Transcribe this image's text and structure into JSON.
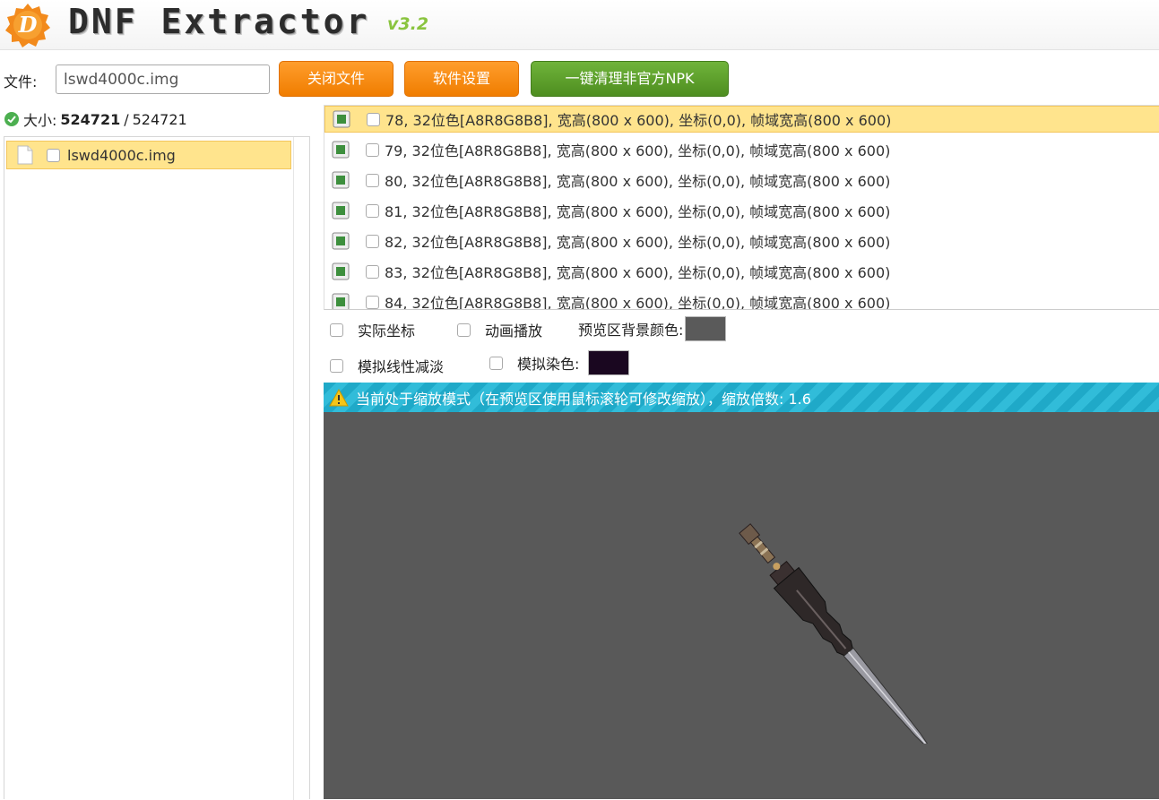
{
  "app": {
    "title": "DNF Extractor",
    "version": "v3.2",
    "logo_letter": "D"
  },
  "toolbar": {
    "file_label": "文件:",
    "file_value": "lswd4000c.img",
    "close_file": "关闭文件",
    "settings": "软件设置",
    "clean_npk": "一键清理非官方NPK"
  },
  "size": {
    "label": "大小:",
    "current": "524721",
    "separator": "/",
    "total": "524721"
  },
  "tree": {
    "items": [
      {
        "label": "lswd4000c.img",
        "selected": true
      }
    ]
  },
  "frames": [
    {
      "text": "78, 32位色[A8R8G8B8], 宽高(800 x 600), 坐标(0,0), 帧域宽高(800 x 600)",
      "selected": true
    },
    {
      "text": "79, 32位色[A8R8G8B8], 宽高(800 x 600), 坐标(0,0), 帧域宽高(800 x 600)",
      "selected": false
    },
    {
      "text": "80, 32位色[A8R8G8B8], 宽高(800 x 600), 坐标(0,0), 帧域宽高(800 x 600)",
      "selected": false
    },
    {
      "text": "81, 32位色[A8R8G8B8], 宽高(800 x 600), 坐标(0,0), 帧域宽高(800 x 600)",
      "selected": false
    },
    {
      "text": "82, 32位色[A8R8G8B8], 宽高(800 x 600), 坐标(0,0), 帧域宽高(800 x 600)",
      "selected": false
    },
    {
      "text": "83, 32位色[A8R8G8B8], 宽高(800 x 600), 坐标(0,0), 帧域宽高(800 x 600)",
      "selected": false
    },
    {
      "text": "84, 32位色[A8R8G8B8], 宽高(800 x 600), 坐标(0,0), 帧域宽高(800 x 600)",
      "selected": false
    }
  ],
  "options": {
    "actual_coords": "实际坐标",
    "animation": "动画播放",
    "bg_color_label": "预览区背景颜色:",
    "bg_color": "#5a5a5a",
    "linear_dodge": "模拟线性减淡",
    "tint_label": "模拟染色:",
    "tint_color": "#1a0720"
  },
  "banner": {
    "text": "当前处于缩放模式（在预览区使用鼠标滚轮可修改缩放），缩放倍数: 1.6"
  },
  "colors": {
    "accent_orange": "#f5860f",
    "accent_green": "#5a9e2a",
    "selection": "#ffe48d",
    "banner": "#23aecb",
    "preview_bg": "#595959"
  }
}
